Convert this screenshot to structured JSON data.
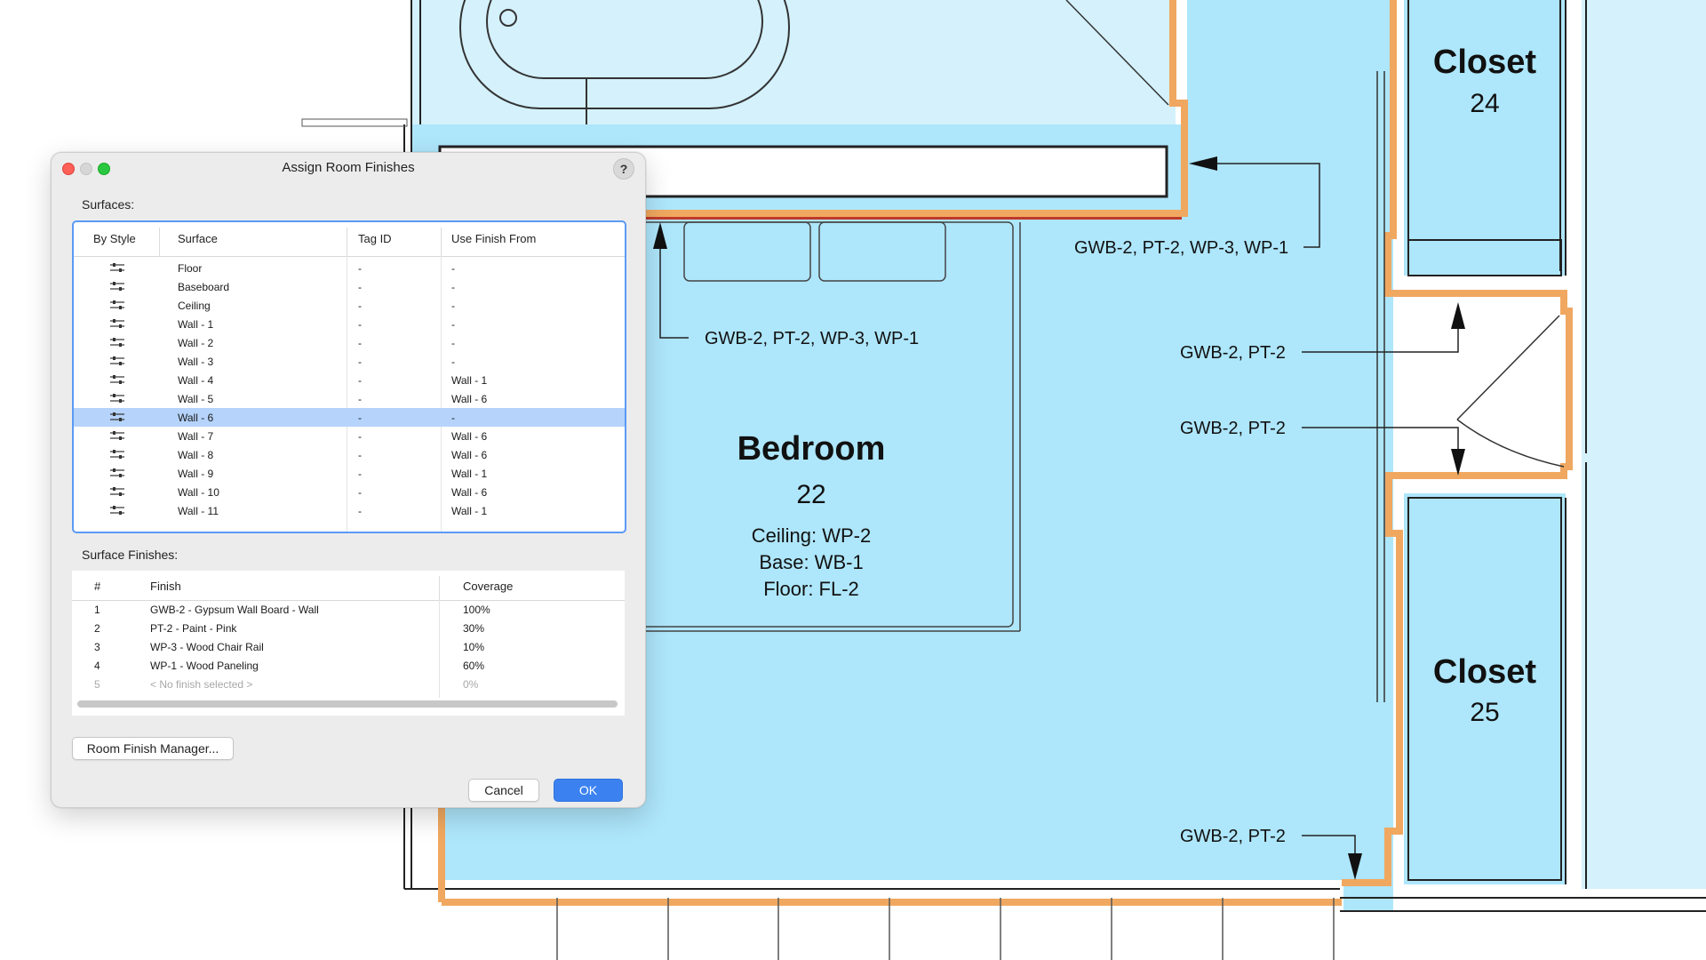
{
  "plan": {
    "rooms": [
      {
        "name": "Closet",
        "number": "24"
      },
      {
        "name": "Bedroom",
        "number": "22",
        "details": [
          "Ceiling: WP-2",
          "Base: WB-1",
          "Floor: FL-2"
        ]
      },
      {
        "name": "Closet",
        "number": "25"
      }
    ],
    "callouts": [
      "GWB-2, PT-2, WP-3, WP-1",
      "GWB-2, PT-2, WP-3, WP-1",
      "GWB-2, PT-2",
      "GWB-2, PT-2",
      "GWB-2, PT-2"
    ],
    "colors": {
      "room_fill": "#aee6fb",
      "wall_highlight": "#f0a860",
      "wall_selected": "#c0392b"
    }
  },
  "dialog": {
    "title": "Assign Room Finishes",
    "help": "?",
    "surfaces_label": "Surfaces:",
    "surfaces_headers": [
      "By Style",
      "Surface",
      "Tag ID",
      "Use Finish From"
    ],
    "surfaces": [
      {
        "surface": "Floor",
        "tag": "-",
        "from": "-"
      },
      {
        "surface": "Baseboard",
        "tag": "-",
        "from": "-"
      },
      {
        "surface": "Ceiling",
        "tag": "-",
        "from": "-"
      },
      {
        "surface": "Wall - 1",
        "tag": "-",
        "from": "-"
      },
      {
        "surface": "Wall - 2",
        "tag": "-",
        "from": "-"
      },
      {
        "surface": "Wall - 3",
        "tag": "-",
        "from": "-"
      },
      {
        "surface": "Wall - 4",
        "tag": "-",
        "from": "Wall - 1"
      },
      {
        "surface": "Wall - 5",
        "tag": "-",
        "from": "Wall - 6"
      },
      {
        "surface": "Wall - 6",
        "tag": "-",
        "from": "-",
        "selected": true
      },
      {
        "surface": "Wall - 7",
        "tag": "-",
        "from": "Wall - 6"
      },
      {
        "surface": "Wall - 8",
        "tag": "-",
        "from": "Wall - 6"
      },
      {
        "surface": "Wall - 9",
        "tag": "-",
        "from": "Wall - 1"
      },
      {
        "surface": "Wall - 10",
        "tag": "-",
        "from": "Wall - 6"
      },
      {
        "surface": "Wall - 11",
        "tag": "-",
        "from": "Wall - 1"
      }
    ],
    "finishes_label": "Surface Finishes:",
    "finishes_headers": [
      "#",
      "Finish",
      "Coverage"
    ],
    "finishes": [
      {
        "num": "1",
        "finish": "GWB-2 - Gypsum Wall Board - Wall",
        "coverage": "100%"
      },
      {
        "num": "2",
        "finish": "PT-2 - Paint - Pink",
        "coverage": "30%"
      },
      {
        "num": "3",
        "finish": "WP-3 - Wood Chair Rail",
        "coverage": "10%"
      },
      {
        "num": "4",
        "finish": "WP-1 - Wood Paneling",
        "coverage": "60%"
      },
      {
        "num": "5",
        "finish": "< No finish selected >",
        "coverage": "0%",
        "placeholder": true
      }
    ],
    "room_finish_manager": "Room Finish Manager...",
    "cancel": "Cancel",
    "ok": "OK"
  }
}
